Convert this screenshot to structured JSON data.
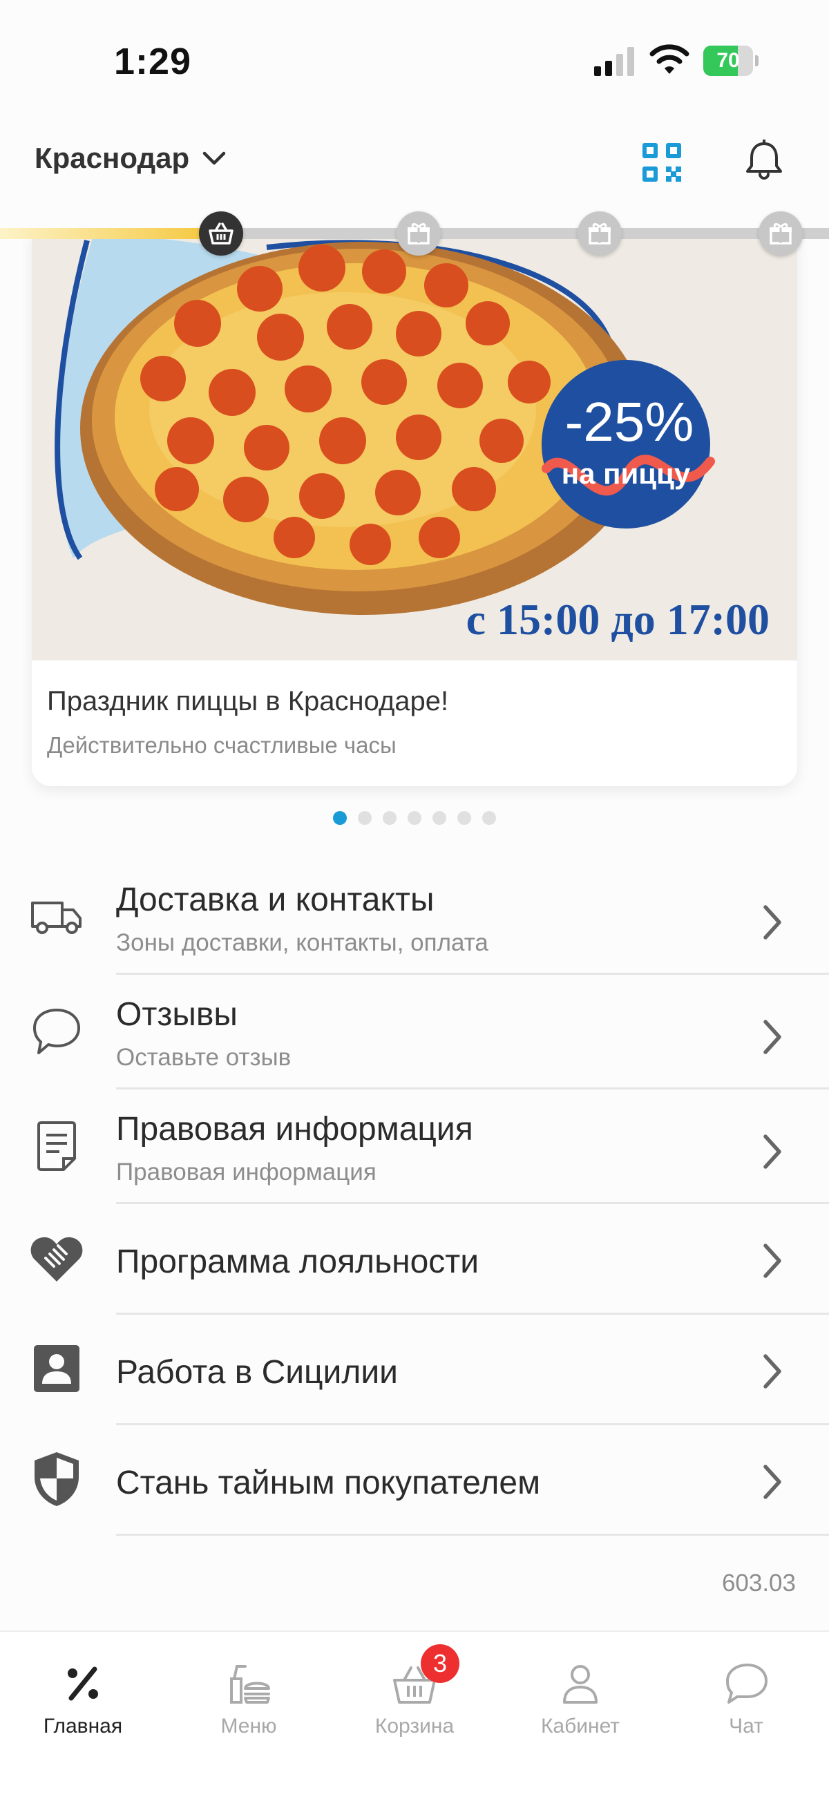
{
  "status_bar": {
    "time": "1:29",
    "battery": "70",
    "battery_level": 0.7
  },
  "header": {
    "city": "Краснодар"
  },
  "progress": {
    "fill_fraction": 0.27,
    "steps": [
      "basket-icon",
      "gift-icon",
      "gift-icon",
      "gift-icon"
    ]
  },
  "banner": {
    "promo_discount": "-25%",
    "promo_sub": "на пиццу",
    "promo_time": "с 15:00 до 17:00",
    "title": "Праздник пиццы в Краснодаре!",
    "subtitle": "Действительно счастливые часы",
    "dots_total": 7,
    "dots_active": 0
  },
  "menu": [
    {
      "icon": "truck-icon",
      "title": "Доставка и контакты",
      "subtitle": "Зоны доставки, контакты, оплата"
    },
    {
      "icon": "chat-bubble-icon",
      "title": "Отзывы",
      "subtitle": "Оставьте отзыв"
    },
    {
      "icon": "document-icon",
      "title": "Правовая информация",
      "subtitle": "Правовая информация"
    },
    {
      "icon": "handshake-heart-icon",
      "title": "Программа лояльности",
      "subtitle": ""
    },
    {
      "icon": "id-badge-icon",
      "title": "Работа в Сицилии",
      "subtitle": ""
    },
    {
      "icon": "shield-icon",
      "title": "Стань тайным покупателем",
      "subtitle": ""
    }
  ],
  "version": "603.03",
  "tabs": [
    {
      "icon": "percent-icon",
      "label": "Главная",
      "active": true
    },
    {
      "icon": "burger-menu-icon",
      "label": "Меню",
      "active": false
    },
    {
      "icon": "basket-icon",
      "label": "Корзина",
      "active": false,
      "badge": "3"
    },
    {
      "icon": "user-icon",
      "label": "Кабинет",
      "active": false
    },
    {
      "icon": "chat-icon",
      "label": "Чат",
      "active": false
    }
  ],
  "colors": {
    "accent": "#1a9ad6",
    "badge": "#ee2f2f",
    "battery": "#34c759",
    "promo_badge": "#1f4fa0"
  }
}
